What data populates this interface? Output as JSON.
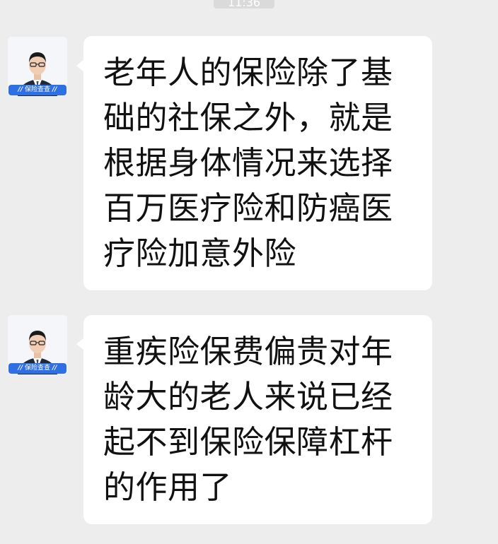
{
  "header": {
    "time": "11:36"
  },
  "messages": [
    {
      "sender_badge": "保险查查",
      "text": "老年人的保险除了基础的社保之外，就是根据身体情况来选择百万医疗险和防癌医疗险加意外险"
    },
    {
      "sender_badge": "保险查查",
      "text": "重疾险保费偏贵对年龄大的老人来说已经起不到保险保障杠杆的作用了"
    }
  ],
  "colors": {
    "background": "#ededed",
    "bubble": "#ffffff",
    "badge": "#2f6fe4",
    "text": "#111111"
  }
}
